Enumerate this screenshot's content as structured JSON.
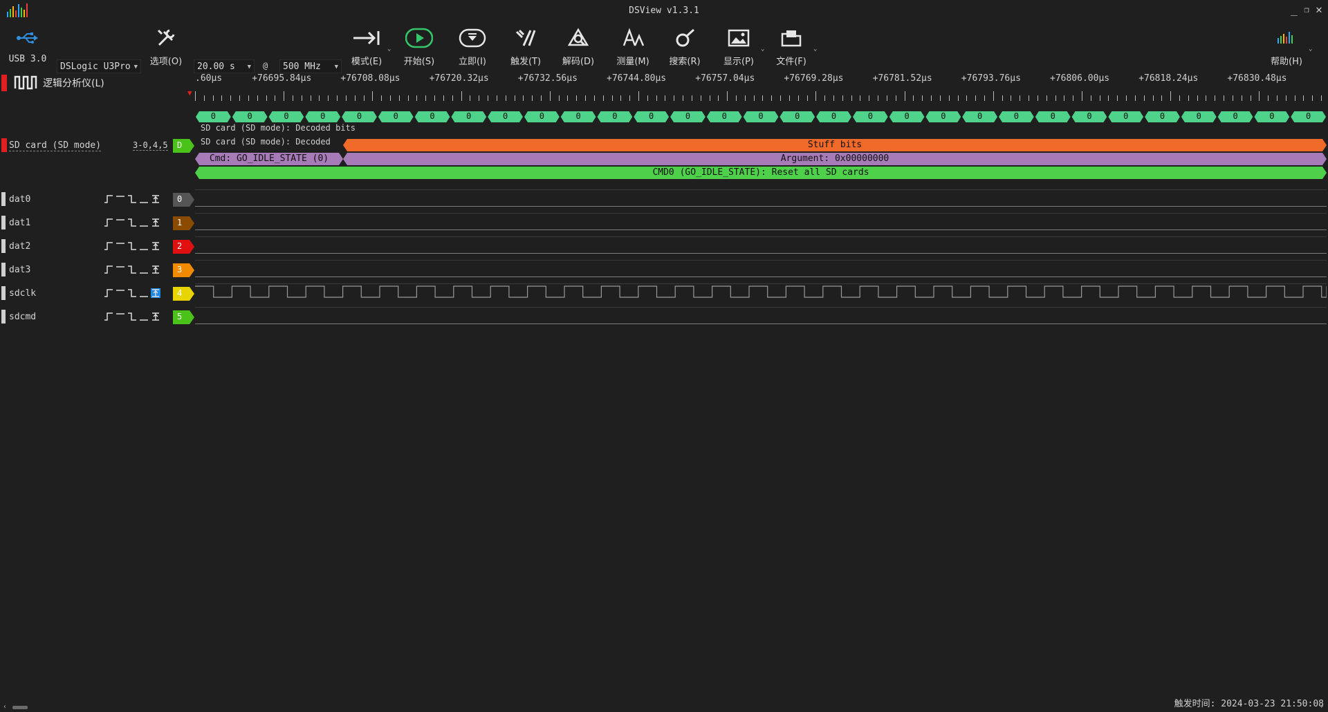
{
  "window": {
    "title": "DSView v1.3.1"
  },
  "toolbar": {
    "usb_label": "USB 3.0",
    "device": "DSLogic U3Pro",
    "options_label": "选项(O)",
    "duration": "20.00 s",
    "at": "@",
    "samplerate": "500 MHz",
    "mode_label": "模式(E)",
    "start_label": "开始(S)",
    "instant_label": "立即(I)",
    "trigger_label": "触发(T)",
    "decode_label": "解码(D)",
    "measure_label": "测量(M)",
    "search_label": "搜索(R)",
    "display_label": "显示(P)",
    "file_label": "文件(F)",
    "help_label": "帮助(H)"
  },
  "panel": {
    "title": "逻辑分析仪(L)"
  },
  "ruler": {
    "ticks": [
      ".60μs",
      "+76695.84μs",
      "+76708.08μs",
      "+76720.32μs",
      "+76732.56μs",
      "+76744.80μs",
      "+76757.04μs",
      "+76769.28μs",
      "+76781.52μs",
      "+76793.76μs",
      "+76806.00μs",
      "+76818.24μs",
      "+76830.48μs"
    ]
  },
  "decoder": {
    "name": "SD card (SD mode)",
    "channels": "3-0,4,5",
    "tag": "D",
    "row_label_bits": "SD card (SD mode): Decoded bits",
    "row_label_fields": "SD card (SD mode): Decoded",
    "bit_value": "0",
    "bits_count": 31,
    "stuff_bits": "Stuff bits",
    "cmd": "Cmd: GO_IDLE_STATE (0)",
    "argument": "Argument: 0x00000000",
    "command_desc": "CMD0 (GO_IDLE_STATE): Reset all SD cards"
  },
  "channels": [
    {
      "name": "dat0",
      "index": "0",
      "color": "#555555"
    },
    {
      "name": "dat1",
      "index": "1",
      "color": "#8a4b00"
    },
    {
      "name": "dat2",
      "index": "2",
      "color": "#e01010"
    },
    {
      "name": "dat3",
      "index": "3",
      "color": "#f08a00"
    },
    {
      "name": "sdclk",
      "index": "4",
      "color": "#e8d400"
    },
    {
      "name": "sdcmd",
      "index": "5",
      "color": "#4bc21a"
    }
  ],
  "colors": {
    "bits_green": "#4fd38a",
    "stuff_orange": "#f06a2a",
    "arg_purple": "#a77ab8",
    "desc_green": "#4fd04a",
    "decoder_tag": "#4bc21a",
    "red_marker": "#e02020"
  },
  "status": {
    "trigger_time": "触发时间: 2024-03-23 21:50:08"
  }
}
